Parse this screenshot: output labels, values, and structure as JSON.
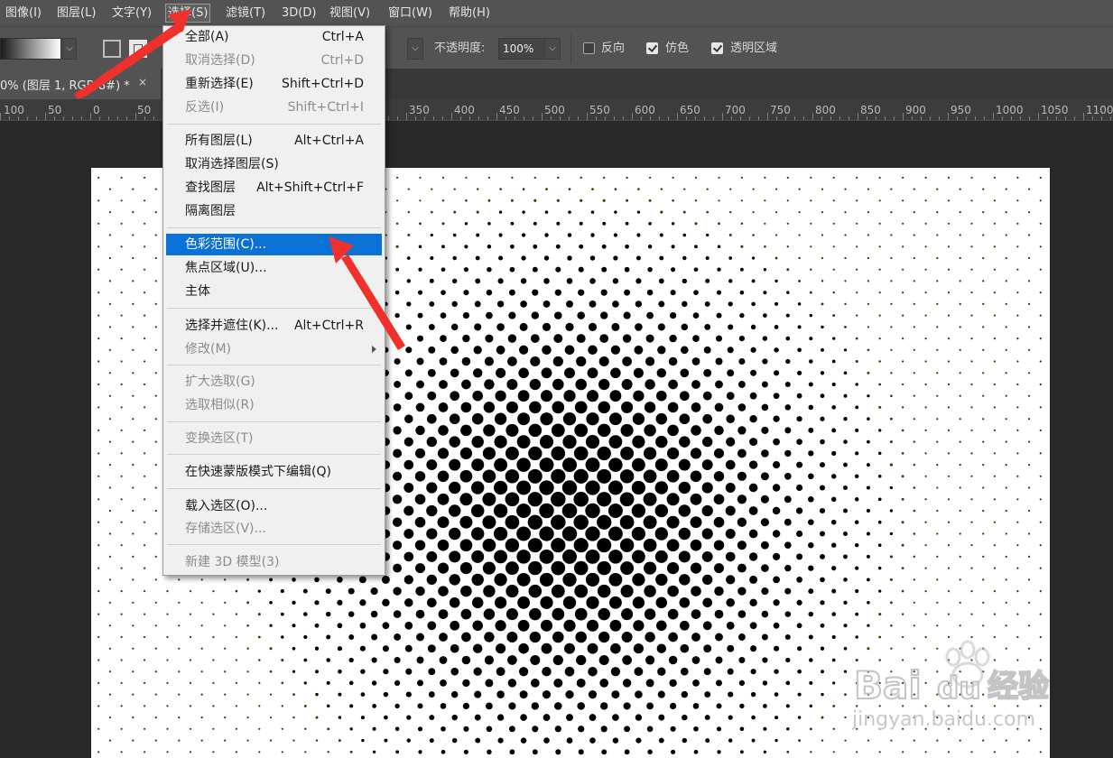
{
  "menubar": {
    "items": [
      {
        "label": "图像(I)",
        "active": false
      },
      {
        "label": "图层(L)",
        "active": false
      },
      {
        "label": "文字(Y)",
        "active": false
      },
      {
        "label": "选择(S)",
        "active": true
      },
      {
        "label": "滤镜(T)",
        "active": false
      },
      {
        "label": "3D(D)",
        "active": false
      },
      {
        "label": "视图(V)",
        "active": false
      },
      {
        "label": "窗口(W)",
        "active": false
      },
      {
        "label": "帮助(H)",
        "active": false
      }
    ]
  },
  "options_bar": {
    "opacity_label": "不透明度:",
    "opacity_value": "100%",
    "reverse_label": "反向",
    "reverse_checked": false,
    "dither_label": "仿色",
    "dither_checked": true,
    "transparency_label": "透明区域",
    "transparency_checked": true
  },
  "document_tab": {
    "label": "0% (图层 1, RGB/8#) *",
    "close_glyph": "×"
  },
  "ruler": {
    "left_labels": [
      "100",
      "50",
      "0",
      "50"
    ],
    "right_labels": [
      "350",
      "400",
      "450",
      "500",
      "550",
      "600",
      "650",
      "700",
      "750",
      "800",
      "850",
      "900",
      "950",
      "1000",
      "1050",
      "1100"
    ]
  },
  "select_menu": {
    "items": [
      {
        "label": "全部(A)",
        "shortcut": "Ctrl+A",
        "disabled": false
      },
      {
        "label": "取消选择(D)",
        "shortcut": "Ctrl+D",
        "disabled": true
      },
      {
        "label": "重新选择(E)",
        "shortcut": "Shift+Ctrl+D",
        "disabled": false
      },
      {
        "label": "反选(I)",
        "shortcut": "Shift+Ctrl+I",
        "disabled": true
      },
      {
        "label": "所有图层(L)",
        "shortcut": "Alt+Ctrl+A",
        "disabled": false
      },
      {
        "label": "取消选择图层(S)",
        "shortcut": "",
        "disabled": false
      },
      {
        "label": "查找图层",
        "shortcut": "Alt+Shift+Ctrl+F",
        "disabled": false
      },
      {
        "label": "隔离图层",
        "shortcut": "",
        "disabled": false
      },
      {
        "label": "色彩范围(C)...",
        "shortcut": "",
        "disabled": false,
        "highlighted": true
      },
      {
        "label": "焦点区域(U)...",
        "shortcut": "",
        "disabled": false
      },
      {
        "label": "主体",
        "shortcut": "",
        "disabled": false
      },
      {
        "label": "选择并遮住(K)...",
        "shortcut": "Alt+Ctrl+R",
        "disabled": false
      },
      {
        "label": "修改(M)",
        "shortcut": "",
        "disabled": true,
        "submenu": true
      },
      {
        "label": "扩大选取(G)",
        "shortcut": "",
        "disabled": true
      },
      {
        "label": "选取相似(R)",
        "shortcut": "",
        "disabled": true
      },
      {
        "label": "变换选区(T)",
        "shortcut": "",
        "disabled": true
      },
      {
        "label": "在快速蒙版模式下编辑(Q)",
        "shortcut": "",
        "disabled": false
      },
      {
        "label": "载入选区(O)...",
        "shortcut": "",
        "disabled": false
      },
      {
        "label": "存储选区(V)...",
        "shortcut": "",
        "disabled": true
      },
      {
        "label": "新建 3D 模型(3)",
        "shortcut": "",
        "disabled": true
      }
    ]
  },
  "watermark": {
    "brand": "Bai",
    "brand_suffix": "du",
    "cn": "经验",
    "url": "jingyan.baidu.com"
  },
  "colors": {
    "menubar_bg": "#535353",
    "menu_highlight": "#0a72d6",
    "annotation_arrow": "#f0302a"
  }
}
